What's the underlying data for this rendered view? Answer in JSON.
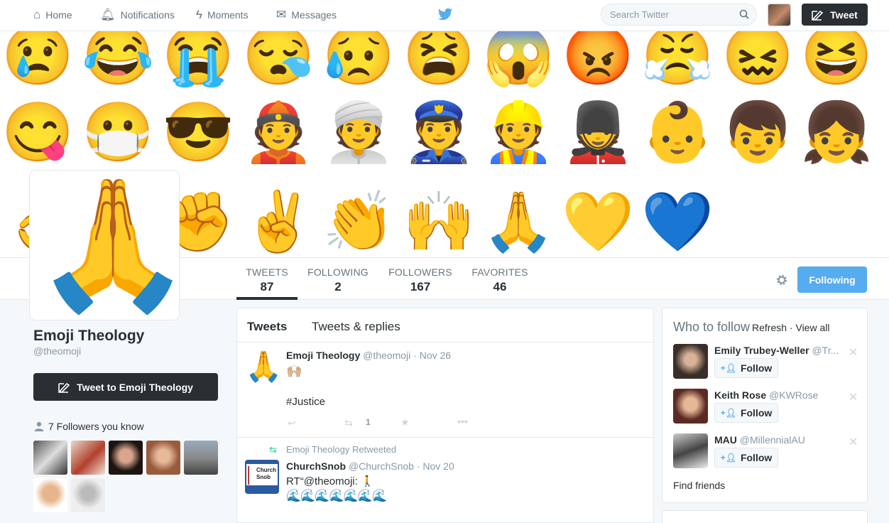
{
  "nav": {
    "home": "Home",
    "notifications": "Notifications",
    "moments": "Moments",
    "messages": "Messages",
    "search_placeholder": "Search Twitter",
    "tweet": "Tweet"
  },
  "banner_emojis": [
    "😢",
    "😂",
    "😭",
    "😪",
    "😥",
    "😫",
    "😱",
    "😡",
    "😤",
    "😖",
    "😆",
    "😋",
    "😷",
    "😎",
    "👲",
    "👳",
    "👮",
    "👷",
    "💂",
    "👶",
    "👦",
    "👧",
    "👌",
    "👊",
    "✊",
    "✌️",
    "👏",
    "🙌",
    "🙏",
    "💛",
    "💙"
  ],
  "profile": {
    "avatar_emoji": "🙏",
    "name": "Emoji Theology",
    "handle": "@theomoji",
    "tweet_to": "Tweet to Emoji Theology",
    "followers_you_know": "7 Followers you know"
  },
  "stats": [
    {
      "label": "TWEETS",
      "value": "87"
    },
    {
      "label": "FOLLOWING",
      "value": "2"
    },
    {
      "label": "FOLLOWERS",
      "value": "167"
    },
    {
      "label": "FAVORITES",
      "value": "46"
    }
  ],
  "following_button": "Following",
  "timeline": {
    "tabs": [
      "Tweets",
      "Tweets & replies"
    ],
    "tweets": [
      {
        "avatar": "🙏",
        "name": "Emoji Theology",
        "handle": "@theomoji",
        "date": "· Nov 26",
        "line1": "🙌🏼",
        "line2": "#Justice",
        "retweets": "1"
      },
      {
        "retweeted_by": "Emoji Theology Retweeted",
        "name": "ChurchSnob",
        "handle": "@ChurchSnob",
        "date": "· Nov 20",
        "avatar_text": "Church Snob",
        "line1": "RT“@theomoji: 🚶",
        "line2": "🌊🌊🌊🌊🌊🌊🌊"
      }
    ]
  },
  "who_to_follow": {
    "title": "Who to follow",
    "refresh": "Refresh",
    "sep": "·",
    "view_all": "View all",
    "follow_label": "Follow",
    "people": [
      {
        "name": "Emily Trubey-Weller",
        "handle": "@Tr..."
      },
      {
        "name": "Keith Rose",
        "handle": "@KWRose"
      },
      {
        "name": "MAU",
        "handle": "@MillennialAU"
      }
    ],
    "find_friends": "Find friends"
  },
  "colors": {
    "accent": "#55acee",
    "dark_button": "#292f33",
    "muted_text": "#8899a6"
  }
}
